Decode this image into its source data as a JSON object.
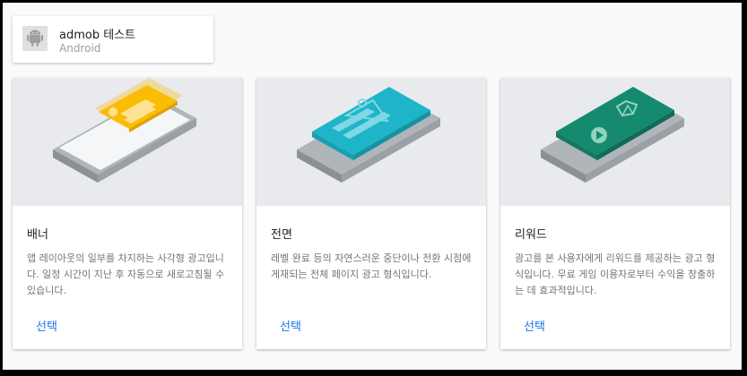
{
  "app": {
    "name": "admob 테스트",
    "platform": "Android",
    "icon": "android-icon"
  },
  "colors": {
    "banner_accent": "#fbbc04",
    "interstitial_accent": "#1fb5c8",
    "rewarded_accent": "#168a6e",
    "link": "#1a73e8"
  },
  "formats": [
    {
      "title": "배너",
      "description": "앱 레이아웃의 일부를 차지하는 사각형 광고입니다. 일정 시간이 지난 후 자동으로 새로고침될 수 있습니다.",
      "action_label": "선택"
    },
    {
      "title": "전면",
      "description": "레벨 완료 등의 자연스러운 중단이나 전환 시점에 게재되는 전체 페이지 광고 형식입니다.",
      "action_label": "선택"
    },
    {
      "title": "리워드",
      "description": "광고를 본 사용자에게 리워드를 제공하는 광고 형식입니다. 무료 게임 이용자로부터 수익을 창출하는 데 효과적입니다.",
      "action_label": "선택"
    }
  ]
}
